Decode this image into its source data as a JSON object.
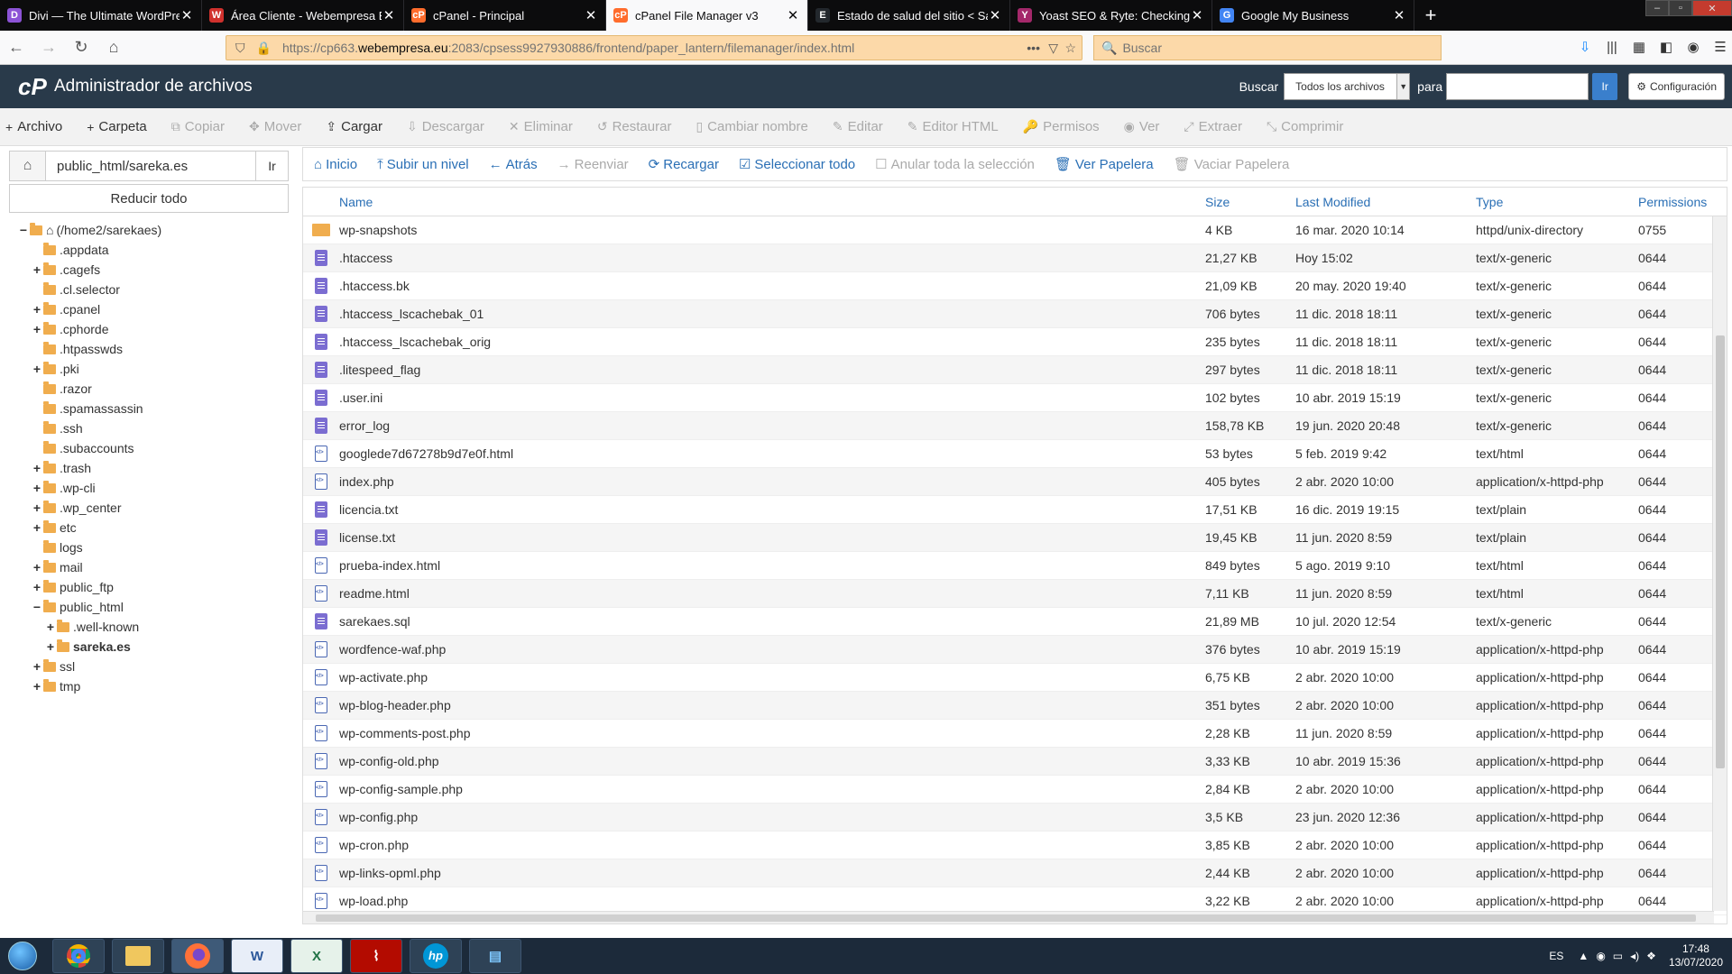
{
  "browser": {
    "tabs": [
      {
        "title": "Divi — The Ultimate WordPress",
        "color": "#8c53d6",
        "glyph": "D"
      },
      {
        "title": "Área Cliente - Webempresa Eu",
        "color": "#d0312d",
        "glyph": "W"
      },
      {
        "title": "cPanel - Principal",
        "color": "#ff6c2c",
        "glyph": "cP"
      },
      {
        "title": "cPanel File Manager v3",
        "color": "#ff6c2c",
        "glyph": "cP"
      },
      {
        "title": "Estado de salud del sitio < Sare",
        "color": "#23282d",
        "glyph": "E"
      },
      {
        "title": "Yoast SEO & Ryte: Checking yo",
        "color": "#a4286a",
        "glyph": "Y"
      },
      {
        "title": "Google My Business",
        "color": "#4285f4",
        "glyph": "G"
      }
    ],
    "url_prefix": "https://cp663.",
    "url_domain": "webempresa.eu",
    "url_rest": ":2083/cpsess9927930886/frontend/paper_lantern/filemanager/index.html",
    "search_placeholder": "Buscar"
  },
  "cpanel": {
    "title": "Administrador de archivos",
    "search_label": "Buscar",
    "search_scope": "Todos los archivos",
    "for_label": "para",
    "go_label": "Ir",
    "settings_label": "Configuración"
  },
  "toolbar": [
    {
      "label": "Archivo",
      "icon": "+",
      "enabled": true
    },
    {
      "label": "Carpeta",
      "icon": "+",
      "enabled": true
    },
    {
      "label": "Copiar",
      "icon": "⧉",
      "enabled": false
    },
    {
      "label": "Mover",
      "icon": "✥",
      "enabled": false
    },
    {
      "label": "Cargar",
      "icon": "⇪",
      "enabled": true
    },
    {
      "label": "Descargar",
      "icon": "⇩",
      "enabled": false
    },
    {
      "label": "Eliminar",
      "icon": "✕",
      "enabled": false
    },
    {
      "label": "Restaurar",
      "icon": "↺",
      "enabled": false
    },
    {
      "label": "Cambiar nombre",
      "icon": "▯",
      "enabled": false
    },
    {
      "label": "Editar",
      "icon": "✎",
      "enabled": false
    },
    {
      "label": "Editor HTML",
      "icon": "✎",
      "enabled": false
    },
    {
      "label": "Permisos",
      "icon": "🔑",
      "enabled": false
    },
    {
      "label": "Ver",
      "icon": "◉",
      "enabled": false
    },
    {
      "label": "Extraer",
      "icon": "⤢",
      "enabled": false
    },
    {
      "label": "Comprimir",
      "icon": "⤡",
      "enabled": false
    }
  ],
  "left": {
    "path_value": "public_html/sareka.es",
    "go_label": "Ir",
    "collapse_label": "Reducir todo",
    "tree": [
      {
        "label": "(/home2/sarekaes)",
        "level": 0,
        "toggle": "−",
        "home": true
      },
      {
        "label": ".appdata",
        "level": 1,
        "toggle": ""
      },
      {
        "label": ".cagefs",
        "level": 1,
        "toggle": "+"
      },
      {
        "label": ".cl.selector",
        "level": 1,
        "toggle": ""
      },
      {
        "label": ".cpanel",
        "level": 1,
        "toggle": "+"
      },
      {
        "label": ".cphorde",
        "level": 1,
        "toggle": "+"
      },
      {
        "label": ".htpasswds",
        "level": 1,
        "toggle": ""
      },
      {
        "label": ".pki",
        "level": 1,
        "toggle": "+"
      },
      {
        "label": ".razor",
        "level": 1,
        "toggle": ""
      },
      {
        "label": ".spamassassin",
        "level": 1,
        "toggle": ""
      },
      {
        "label": ".ssh",
        "level": 1,
        "toggle": ""
      },
      {
        "label": ".subaccounts",
        "level": 1,
        "toggle": ""
      },
      {
        "label": ".trash",
        "level": 1,
        "toggle": "+"
      },
      {
        "label": ".wp-cli",
        "level": 1,
        "toggle": "+"
      },
      {
        "label": ".wp_center",
        "level": 1,
        "toggle": "+"
      },
      {
        "label": "etc",
        "level": 1,
        "toggle": "+"
      },
      {
        "label": "logs",
        "level": 1,
        "toggle": ""
      },
      {
        "label": "mail",
        "level": 1,
        "toggle": "+"
      },
      {
        "label": "public_ftp",
        "level": 1,
        "toggle": "+"
      },
      {
        "label": "public_html",
        "level": 1,
        "toggle": "−"
      },
      {
        "label": ".well-known",
        "level": 2,
        "toggle": "+"
      },
      {
        "label": "sareka.es",
        "level": 2,
        "toggle": "+",
        "bold": true
      },
      {
        "label": "ssl",
        "level": 1,
        "toggle": "+"
      },
      {
        "label": "tmp",
        "level": 1,
        "toggle": "+"
      }
    ]
  },
  "rtoolbar": [
    {
      "label": "Inicio",
      "icon": "⌂",
      "enabled": true
    },
    {
      "label": "Subir un nivel",
      "icon": "⤒",
      "enabled": true
    },
    {
      "label": "Atrás",
      "icon": "←",
      "enabled": true
    },
    {
      "label": "Reenviar",
      "icon": "→",
      "enabled": false
    },
    {
      "label": "Recargar",
      "icon": "⟳",
      "enabled": true
    },
    {
      "label": "Seleccionar todo",
      "icon": "☑",
      "enabled": true
    },
    {
      "label": "Anular toda la selección",
      "icon": "☐",
      "enabled": false
    },
    {
      "label": "Ver Papelera",
      "icon": "🗑",
      "enabled": true
    },
    {
      "label": "Vaciar Papelera",
      "icon": "🗑",
      "enabled": false
    }
  ],
  "table": {
    "headers": {
      "name": "Name",
      "size": "Size",
      "modified": "Last Modified",
      "type": "Type",
      "perms": "Permissions"
    },
    "rows": [
      {
        "icon": "folder",
        "name": "wp-snapshots",
        "size": "4 KB",
        "modified": "16 mar. 2020 10:14",
        "type": "httpd/unix-directory",
        "perms": "0755"
      },
      {
        "icon": "doc",
        "name": ".htaccess",
        "size": "21,27 KB",
        "modified": "Hoy 15:02",
        "type": "text/x-generic",
        "perms": "0644"
      },
      {
        "icon": "doc",
        "name": ".htaccess.bk",
        "size": "21,09 KB",
        "modified": "20 may. 2020 19:40",
        "type": "text/x-generic",
        "perms": "0644"
      },
      {
        "icon": "doc",
        "name": ".htaccess_lscachebak_01",
        "size": "706 bytes",
        "modified": "11 dic. 2018 18:11",
        "type": "text/x-generic",
        "perms": "0644"
      },
      {
        "icon": "doc",
        "name": ".htaccess_lscachebak_orig",
        "size": "235 bytes",
        "modified": "11 dic. 2018 18:11",
        "type": "text/x-generic",
        "perms": "0644"
      },
      {
        "icon": "doc",
        "name": ".litespeed_flag",
        "size": "297 bytes",
        "modified": "11 dic. 2018 18:11",
        "type": "text/x-generic",
        "perms": "0644"
      },
      {
        "icon": "doc",
        "name": ".user.ini",
        "size": "102 bytes",
        "modified": "10 abr. 2019 15:19",
        "type": "text/x-generic",
        "perms": "0644"
      },
      {
        "icon": "doc",
        "name": "error_log",
        "size": "158,78 KB",
        "modified": "19 jun. 2020 20:48",
        "type": "text/x-generic",
        "perms": "0644"
      },
      {
        "icon": "code",
        "name": "googlede7d67278b9d7e0f.html",
        "size": "53 bytes",
        "modified": "5 feb. 2019 9:42",
        "type": "text/html",
        "perms": "0644"
      },
      {
        "icon": "code",
        "name": "index.php",
        "size": "405 bytes",
        "modified": "2 abr. 2020 10:00",
        "type": "application/x-httpd-php",
        "perms": "0644"
      },
      {
        "icon": "doc",
        "name": "licencia.txt",
        "size": "17,51 KB",
        "modified": "16 dic. 2019 19:15",
        "type": "text/plain",
        "perms": "0644"
      },
      {
        "icon": "doc",
        "name": "license.txt",
        "size": "19,45 KB",
        "modified": "11 jun. 2020 8:59",
        "type": "text/plain",
        "perms": "0644"
      },
      {
        "icon": "code",
        "name": "prueba-index.html",
        "size": "849 bytes",
        "modified": "5 ago. 2019 9:10",
        "type": "text/html",
        "perms": "0644"
      },
      {
        "icon": "code",
        "name": "readme.html",
        "size": "7,11 KB",
        "modified": "11 jun. 2020 8:59",
        "type": "text/html",
        "perms": "0644"
      },
      {
        "icon": "doc",
        "name": "sarekaes.sql",
        "size": "21,89 MB",
        "modified": "10 jul. 2020 12:54",
        "type": "text/x-generic",
        "perms": "0644"
      },
      {
        "icon": "code",
        "name": "wordfence-waf.php",
        "size": "376 bytes",
        "modified": "10 abr. 2019 15:19",
        "type": "application/x-httpd-php",
        "perms": "0644"
      },
      {
        "icon": "code",
        "name": "wp-activate.php",
        "size": "6,75 KB",
        "modified": "2 abr. 2020 10:00",
        "type": "application/x-httpd-php",
        "perms": "0644"
      },
      {
        "icon": "code",
        "name": "wp-blog-header.php",
        "size": "351 bytes",
        "modified": "2 abr. 2020 10:00",
        "type": "application/x-httpd-php",
        "perms": "0644"
      },
      {
        "icon": "code",
        "name": "wp-comments-post.php",
        "size": "2,28 KB",
        "modified": "11 jun. 2020 8:59",
        "type": "application/x-httpd-php",
        "perms": "0644"
      },
      {
        "icon": "code",
        "name": "wp-config-old.php",
        "size": "3,33 KB",
        "modified": "10 abr. 2019 15:36",
        "type": "application/x-httpd-php",
        "perms": "0644"
      },
      {
        "icon": "code",
        "name": "wp-config-sample.php",
        "size": "2,84 KB",
        "modified": "2 abr. 2020 10:00",
        "type": "application/x-httpd-php",
        "perms": "0644"
      },
      {
        "icon": "code",
        "name": "wp-config.php",
        "size": "3,5 KB",
        "modified": "23 jun. 2020 12:36",
        "type": "application/x-httpd-php",
        "perms": "0644"
      },
      {
        "icon": "code",
        "name": "wp-cron.php",
        "size": "3,85 KB",
        "modified": "2 abr. 2020 10:00",
        "type": "application/x-httpd-php",
        "perms": "0644"
      },
      {
        "icon": "code",
        "name": "wp-links-opml.php",
        "size": "2,44 KB",
        "modified": "2 abr. 2020 10:00",
        "type": "application/x-httpd-php",
        "perms": "0644"
      },
      {
        "icon": "code",
        "name": "wp-load.php",
        "size": "3,22 KB",
        "modified": "2 abr. 2020 10:00",
        "type": "application/x-httpd-php",
        "perms": "0644"
      }
    ]
  },
  "taskbar": {
    "apps": [
      "chrome",
      "explorer",
      "firefox",
      "W",
      "X",
      "pdf",
      "hp",
      "scanner"
    ],
    "lang": "ES",
    "time": "17:48",
    "date": "13/07/2020"
  }
}
